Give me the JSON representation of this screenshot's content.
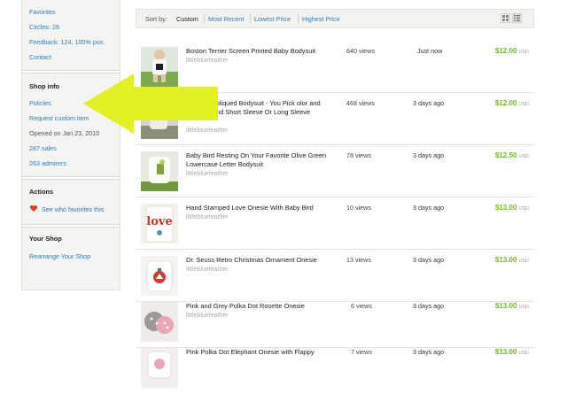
{
  "sidebar": {
    "top_links": [
      "Favorites",
      "Circles: 26",
      "Feedback: 124, 100% pos.",
      "Contact"
    ],
    "shop_info": {
      "heading": "Shop info",
      "policies": "Policies",
      "request": "Request custom item",
      "opened": "Opened on Jan 23, 2010",
      "sales": "287 sales",
      "admirers": "263 admirers"
    },
    "actions": {
      "heading": "Actions",
      "favorites": "See who favorites this"
    },
    "your_shop": {
      "heading": "Your Shop",
      "rearrange": "Rearrange Your Shop"
    }
  },
  "sort": {
    "label": "Sort by:",
    "options": [
      "Custom",
      "Most Recent",
      "Lowest Price",
      "Highest Price"
    ],
    "active": "Custom"
  },
  "listings": [
    {
      "title": "Boston Terrier Screen Printed Baby Bodysuit",
      "shop": "littlebluefeather",
      "views": "640 views",
      "date": "Just now",
      "price": "$12.00",
      "currency": "USD"
    },
    {
      "title": "r Africa Appliqued Bodysuit - You Pick olor and Location and Short Sleeve Or Long Sleeve",
      "shop": "littlebluefeather",
      "views": "468 views",
      "date": "3 days ago",
      "price": "$12.00",
      "currency": "USD"
    },
    {
      "title": "Baby Bird Resting On Your Favorite Olive Green Lowercase Letter Bodysuit",
      "shop": "littlebluefeather",
      "views": "78 views",
      "date": "3 days ago",
      "price": "$12.50",
      "currency": "USD"
    },
    {
      "title": "Hand Stamped Love Onesie With Baby Bird",
      "shop": "littlebluefeather",
      "views": "10 views",
      "date": "3 days ago",
      "price": "$13.00",
      "currency": "USD"
    },
    {
      "title": "Dr. Seuss Retro Christmas Ornament Onesie",
      "shop": "littlebluefeather",
      "views": "13 views",
      "date": "3 days ago",
      "price": "$13.00",
      "currency": "USD"
    },
    {
      "title": "Pink and Grey Polka Dot Rosette Onesie",
      "shop": "littlebluefeather",
      "views": "6 views",
      "date": "3 days ago",
      "price": "$13.00",
      "currency": "USD"
    },
    {
      "title": "Pink Polka Dot Elephant Onesie with Flappy",
      "shop": "",
      "views": "7 views",
      "date": "3 days ago",
      "price": "$13.00",
      "currency": "USD"
    }
  ],
  "thumbnails": {
    "love_text": "love"
  },
  "colors": {
    "link": "#2a7fb8",
    "price": "#6bbf1a",
    "arrow": "#e2f024",
    "sidebar_bg": "#f4f4f2"
  }
}
